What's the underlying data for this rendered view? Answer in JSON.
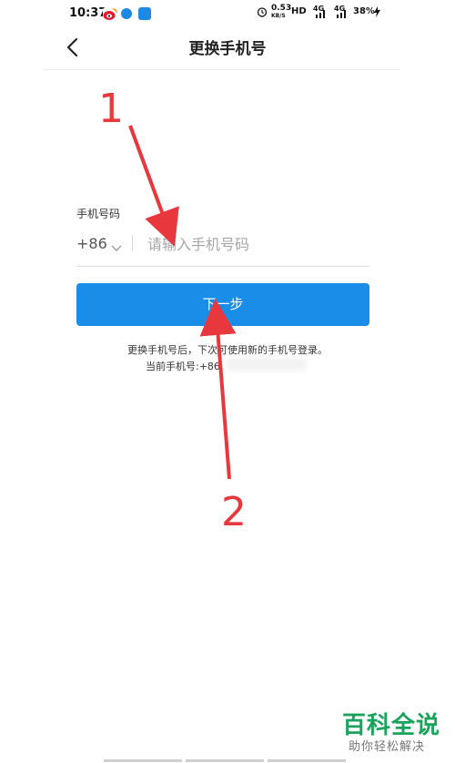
{
  "status_bar": {
    "time": "10:37",
    "speed_value": "0.53",
    "speed_unit": "KB/S",
    "hd": "HD",
    "signal1_label": "4G",
    "signal2_label": "4G",
    "battery": "38%"
  },
  "header": {
    "title": "更换手机号"
  },
  "form": {
    "label": "手机号码",
    "country_code": "+86",
    "phone_placeholder": "请输入手机号码",
    "phone_value": "",
    "submit_label": "下一步"
  },
  "hints": {
    "line1": "更换手机号后，下次可使用新的手机号登录。",
    "line2": "当前手机号:+86"
  },
  "annotations": {
    "marker1": "1",
    "marker2": "2",
    "color": "#e8383d"
  },
  "watermark": {
    "title": "百科全说",
    "subtitle": "助你轻松解决"
  },
  "colors": {
    "accent": "#1a8de9",
    "watermark": "#1aa35a"
  }
}
